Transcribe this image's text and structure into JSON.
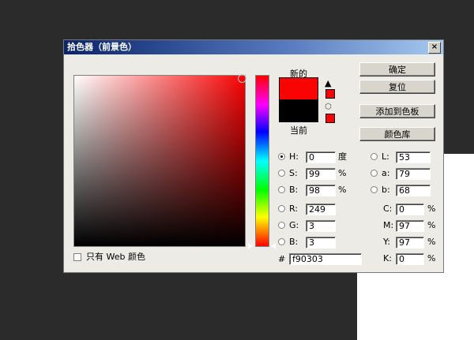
{
  "dialog": {
    "title": "拾色器（前景色）",
    "close_label": "×"
  },
  "preview": {
    "new_label": "新的",
    "current_label": "当前",
    "new_color": "#f90303",
    "current_color": "#000000"
  },
  "buttons": {
    "ok": "确定",
    "reset": "复位",
    "add_to_swatches": "添加到色板",
    "color_libraries": "颜色库"
  },
  "hsb": {
    "h_label": "H:",
    "h_value": "0",
    "h_unit": "度",
    "s_label": "S:",
    "s_value": "99",
    "s_unit": "%",
    "b_label": "B:",
    "b_value": "98",
    "b_unit": "%"
  },
  "rgb": {
    "r_label": "R:",
    "r_value": "249",
    "g_label": "G:",
    "g_value": "3",
    "b_label": "B:",
    "b_value": "3"
  },
  "lab": {
    "l_label": "L:",
    "l_value": "53",
    "a_label": "a:",
    "a_value": "79",
    "b_label": "b:",
    "b_value": "68"
  },
  "cmyk": {
    "c_label": "C:",
    "c_value": "0",
    "c_unit": "%",
    "m_label": "M:",
    "m_value": "97",
    "m_unit": "%",
    "y_label": "Y:",
    "y_value": "97",
    "y_unit": "%",
    "k_label": "K:",
    "k_value": "0",
    "k_unit": "%"
  },
  "hex": {
    "label": "#",
    "value": "f90303"
  },
  "web_only": {
    "label": "只有 Web 颜色",
    "checked": false
  },
  "selected_mode": "H"
}
